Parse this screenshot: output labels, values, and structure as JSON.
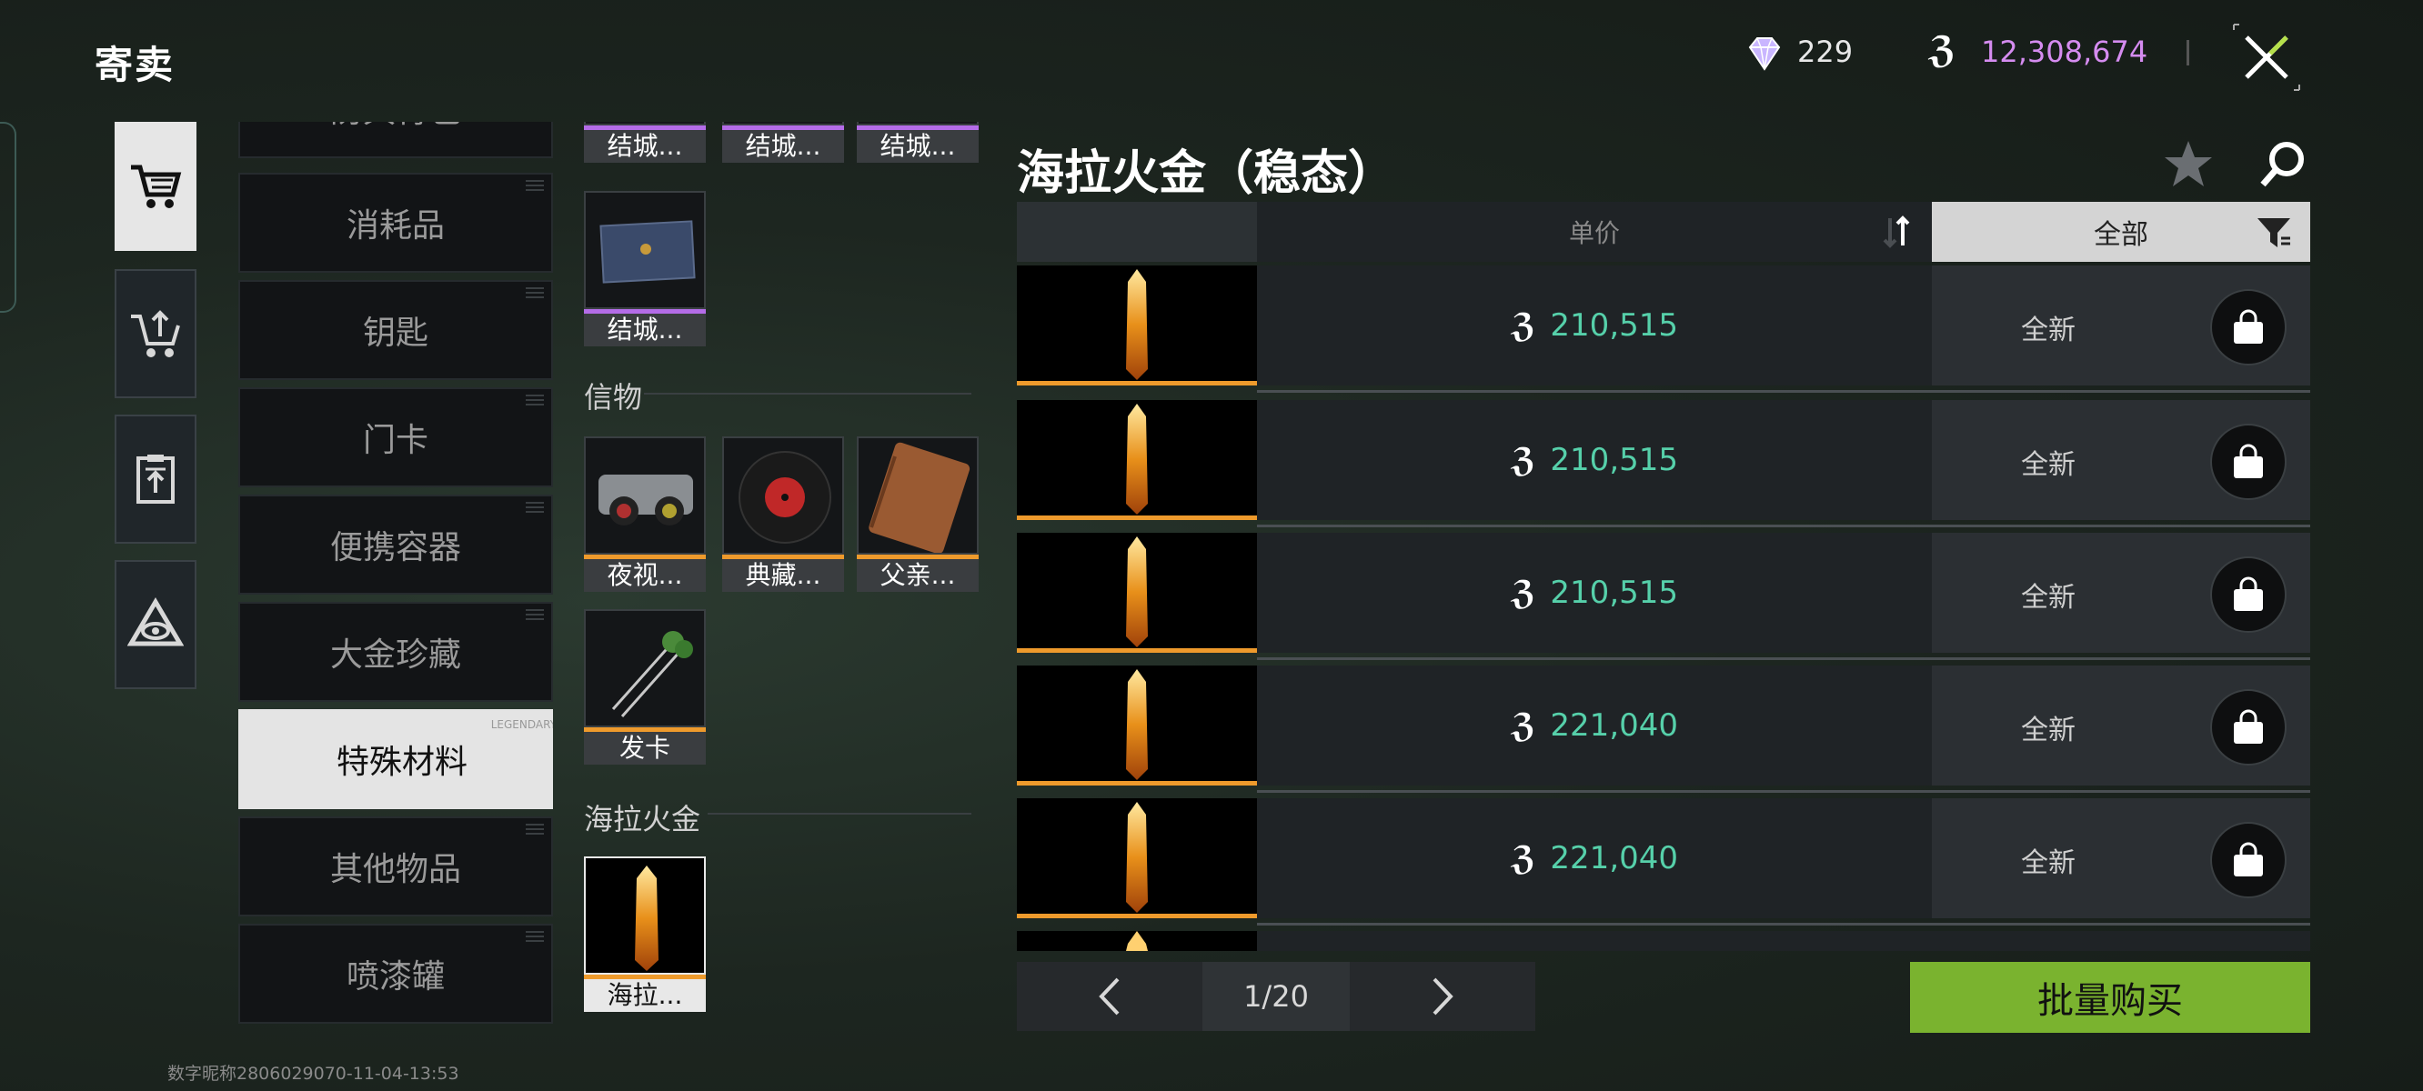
{
  "header": {
    "title": "寄卖",
    "gems": "229",
    "money": "12,308,674",
    "coin_icon": "ℨ"
  },
  "side_tabs": [
    {
      "icon": "cart-icon",
      "active": true
    },
    {
      "icon": "sell-cart-icon",
      "active": false
    },
    {
      "icon": "clipboard-upload-icon",
      "active": false
    },
    {
      "icon": "triangle-eye-icon",
      "active": false
    }
  ],
  "categories": {
    "items": [
      "防具背包",
      "消耗品",
      "钥匙",
      "门卡",
      "便携容器",
      "大金珍藏",
      "特殊材料",
      "其他物品",
      "喷漆罐"
    ],
    "active_watermark": "LEGENDARY"
  },
  "grid": {
    "top_tiles": [
      "结城...",
      "结城...",
      "结城..."
    ],
    "mid_tile": "结城...",
    "section1": "信物",
    "section1_tiles": [
      "夜视...",
      "典藏...",
      "父亲..."
    ],
    "section1_tile4": "发卡",
    "section2": "海拉火金",
    "section2_tile": "海拉..."
  },
  "main": {
    "title": "海拉火金（稳态）",
    "col_price": "单价",
    "col_filter": "全部",
    "rows": [
      {
        "price": "210,515",
        "condition": "全新"
      },
      {
        "price": "210,515",
        "condition": "全新"
      },
      {
        "price": "210,515",
        "condition": "全新"
      },
      {
        "price": "221,040",
        "condition": "全新"
      },
      {
        "price": "221,040",
        "condition": "全新"
      }
    ],
    "page": "1/20",
    "bulk_buy": "批量购买"
  },
  "footer": "数字昵称2806029070-11-04-13:53",
  "colors": {
    "price": "#56d0aa",
    "money": "#d58cf0",
    "accent_orange": "#ee9a2c",
    "rarity_purple": "#b46ce8",
    "bulk_green": "#7ab32f"
  }
}
